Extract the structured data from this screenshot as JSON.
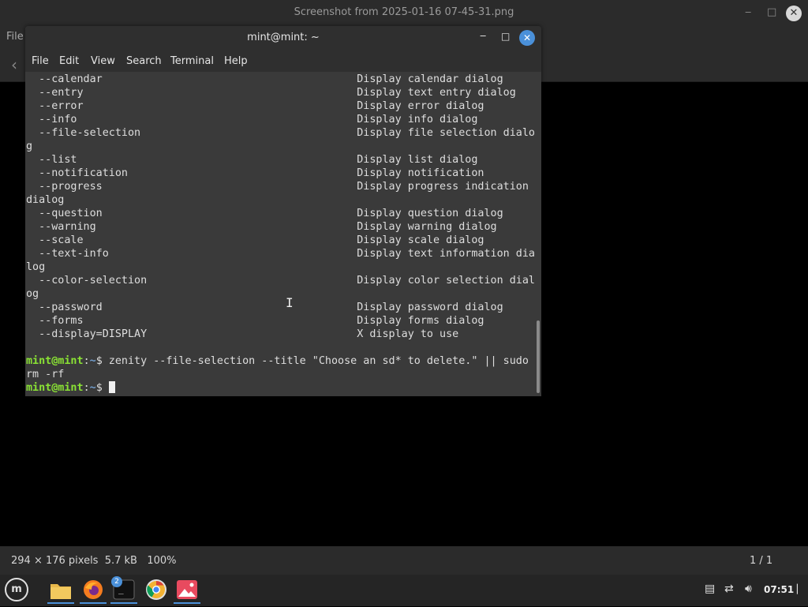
{
  "viewer": {
    "title": "Screenshot from 2025-01-16 07-45-31.png",
    "menu_file": "File",
    "status_info": "294 × 176 pixels  5.7 kB   100%",
    "status_page": "1 / 1"
  },
  "terminal": {
    "title": "mint@mint: ~",
    "menus": [
      "File",
      "Edit",
      "View",
      "Search",
      "Terminal",
      "Help"
    ],
    "lines": [
      "  --calendar                                        Display calendar dialog",
      "  --entry                                           Display text entry dialog",
      "  --error                                           Display error dialog",
      "  --info                                            Display info dialog",
      "  --file-selection                                  Display file selection dialo",
      "g",
      "  --list                                            Display list dialog",
      "  --notification                                    Display notification",
      "  --progress                                        Display progress indication",
      "dialog",
      "  --question                                        Display question dialog",
      "  --warning                                         Display warning dialog",
      "  --scale                                           Display scale dialog",
      "  --text-info                                       Display text information dia",
      "log",
      "  --color-selection                                 Display color selection dial",
      "og",
      "  --password                                        Display password dialog",
      "  --forms                                           Display forms dialog",
      "  --display=DISPLAY                                 X display to use",
      ""
    ],
    "prompt_user": "mint@mint",
    "prompt_dir": "~",
    "command_1": "$ zenity --file-selection --title \"Choose an sd* to delete.\" || sudo",
    "command_1_wrap": "rm -rf",
    "command_2": "$ "
  },
  "taskbar": {
    "clock": "07:51",
    "terminal_badge": "2",
    "menu_logo": "m"
  }
}
